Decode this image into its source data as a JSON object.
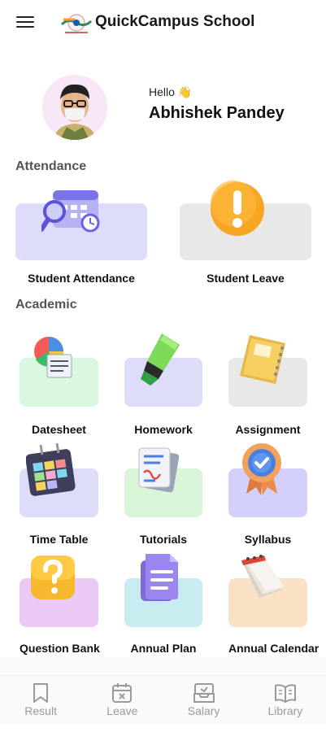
{
  "header": {
    "title": "QuickCampus School"
  },
  "profile": {
    "greeting": "Hello 👋",
    "name": "Abhishek Pandey"
  },
  "sections": {
    "attendance": "Attendance",
    "academic": "Academic"
  },
  "attendance_items": [
    {
      "label": "Student Attendance",
      "icon": "calendar-search-icon",
      "card_color": "#dedcfb"
    },
    {
      "label": "Student Leave",
      "icon": "exclamation-icon",
      "card_color": "#e8e8e8"
    }
  ],
  "academic_items": [
    {
      "label": "Datesheet",
      "icon": "pie-chart-document-icon",
      "card_color": "#d9f8df"
    },
    {
      "label": "Homework",
      "icon": "highlighter-icon",
      "card_color": "#dedcfb"
    },
    {
      "label": "Assignment",
      "icon": "notebook-icon",
      "card_color": "#e8e8e8"
    },
    {
      "label": "Time Table",
      "icon": "timetable-calendar-icon",
      "card_color": "#dedcfb"
    },
    {
      "label": "Tutorials",
      "icon": "documents-icon",
      "card_color": "#d9f4d6"
    },
    {
      "label": "Syllabus",
      "icon": "badge-check-icon",
      "card_color": "#d3d0fb"
    },
    {
      "label": "Question Bank",
      "icon": "question-icon",
      "card_color": "#ecc8f5"
    },
    {
      "label": "Annual Plan",
      "icon": "document-lines-icon",
      "card_color": "#c9ecf0"
    },
    {
      "label": "Annual Calendar",
      "icon": "desk-calendar-icon",
      "card_color": "#fbe1c6"
    }
  ],
  "bottom_nav": [
    {
      "label": "Result",
      "icon": "bookmark-icon"
    },
    {
      "label": "Leave",
      "icon": "calendar-x-icon"
    },
    {
      "label": "Salary",
      "icon": "wallet-icon"
    },
    {
      "label": "Library",
      "icon": "open-book-icon"
    }
  ]
}
